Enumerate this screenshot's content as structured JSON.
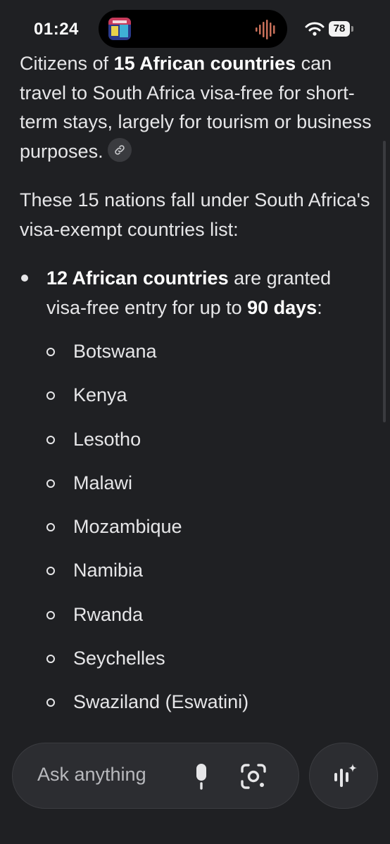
{
  "status_bar": {
    "time": "01:24",
    "battery": "78"
  },
  "content": {
    "paragraph1": {
      "prefix": "Citizens of ",
      "bold": "15 African countries",
      "suffix": " can travel to South Africa visa-free for short-term stays, largely for tourism or business purposes."
    },
    "paragraph2": "These 15 nations fall under South Africa's visa-exempt countries list:",
    "bullet": {
      "bold1": "12 African countries",
      "mid": " are granted visa-free entry for up to ",
      "bold2": "90 days",
      "end": ":"
    },
    "countries": [
      "Botswana",
      "Kenya",
      "Lesotho",
      "Malawi",
      "Mozambique",
      "Namibia",
      "Rwanda",
      "Seychelles",
      "Swaziland (Eswatini)"
    ]
  },
  "input": {
    "placeholder": "Ask anything"
  },
  "icons": {
    "link": "link-icon",
    "mic": "microphone-icon",
    "lens": "camera-lens-icon",
    "live": "live-sparkle-icon",
    "wifi": "wifi-icon"
  }
}
